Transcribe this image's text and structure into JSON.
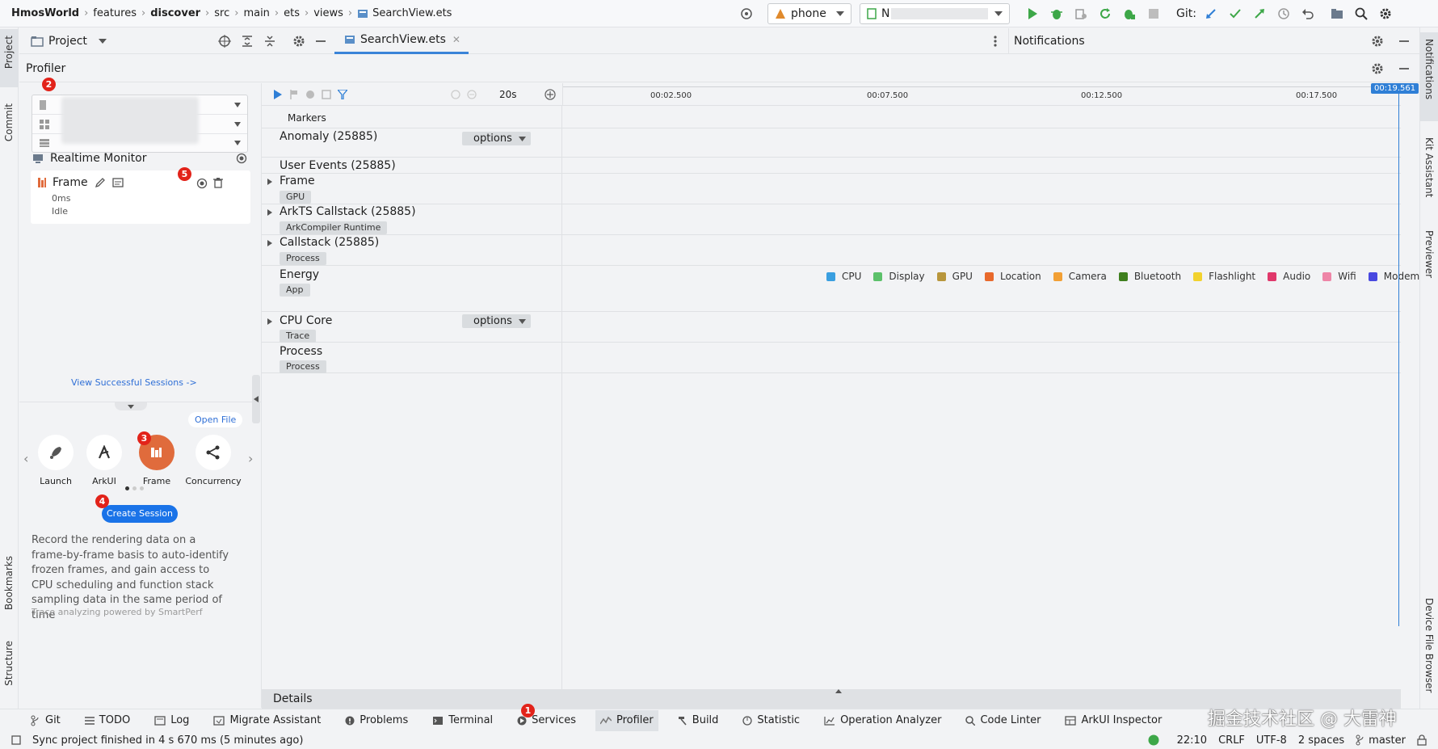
{
  "breadcrumb": [
    "HmosWorld",
    "features",
    "discover",
    "src",
    "main",
    "ets",
    "views",
    "SearchView.ets"
  ],
  "toolbar": {
    "device": "phone",
    "module": "N",
    "git_label": "Git:"
  },
  "project_panel": {
    "label": "Project"
  },
  "editor_tab": {
    "label": "SearchView.ets"
  },
  "notifications": {
    "label": "Notifications"
  },
  "profiler": {
    "title": "Profiler"
  },
  "sessions": {
    "realtime_monitor": "Realtime Monitor",
    "frame_title": "Frame",
    "frame_time": "0ms",
    "frame_status": "Idle",
    "view_sessions": "View Successful Sessions ->"
  },
  "templates": {
    "open_file": "Open File",
    "items": [
      "Launch",
      "ArkUI",
      "Frame",
      "Concurrency"
    ],
    "create_session": "Create Session",
    "description": "Record the rendering data on a frame-by-frame basis to auto-identify frozen frames, and gain access to CPU scheduling and function stack sampling data in the same period of time",
    "powered_by": "Trace analyzing powered by SmartPerf"
  },
  "badges": [
    "1",
    "2",
    "3",
    "4",
    "5"
  ],
  "timeline": {
    "duration": "20s",
    "ticks": [
      "00:02.500",
      "00:07.500",
      "00:12.500",
      "00:17.500"
    ],
    "current_time": "00:19.561"
  },
  "tracks": {
    "markers": "Markers",
    "anomaly": "Anomaly (25885)",
    "options": "options",
    "user_events": "User Events (25885)",
    "frame": "Frame",
    "frame_tag": "GPU",
    "arkts": "ArkTS Callstack (25885)",
    "arkts_tag": "ArkCompiler Runtime",
    "callstack": "Callstack (25885)",
    "callstack_tag": "Process",
    "energy": "Energy",
    "energy_tag": "App",
    "cpu_core": "CPU Core",
    "cpu_core_tag": "Trace",
    "process": "Process",
    "process_tag": "Process"
  },
  "energy_legend": [
    {
      "label": "CPU",
      "color": "#3a9fe0"
    },
    {
      "label": "Display",
      "color": "#5cc16a"
    },
    {
      "label": "GPU",
      "color": "#b8963c"
    },
    {
      "label": "Location",
      "color": "#e8692c"
    },
    {
      "label": "Camera",
      "color": "#f2a035"
    },
    {
      "label": "Bluetooth",
      "color": "#3f7f1e"
    },
    {
      "label": "Flashlight",
      "color": "#f2d22e"
    },
    {
      "label": "Audio",
      "color": "#e0386b"
    },
    {
      "label": "Wifi",
      "color": "#ee85a7"
    },
    {
      "label": "Modem",
      "color": "#4848e0"
    }
  ],
  "details": {
    "label": "Details"
  },
  "bottom_tabs": [
    "Git",
    "TODO",
    "Log",
    "Migrate Assistant",
    "Problems",
    "Terminal",
    "Services",
    "Profiler",
    "Build",
    "Statistic",
    "Operation Analyzer",
    "Code Linter",
    "ArkUI Inspector"
  ],
  "status": {
    "message": "Sync project finished in 4 s 670 ms (5 minutes ago)",
    "time": "22:10",
    "line_ending": "CRLF",
    "encoding": "UTF-8",
    "indent": "2 spaces",
    "branch": "master"
  },
  "left_strip": [
    "Project",
    "Commit",
    "Bookmarks",
    "Structure"
  ],
  "right_strip": [
    "Notifications",
    "Kit Assistant",
    "Previewer",
    "Device File Browser"
  ],
  "watermark": "掘金技术社区 @ 大雷神",
  "colors": {
    "accent": "#1a73e8",
    "frame_orange": "#e06b3c",
    "badge_red": "#e2231a",
    "run_green": "#3da748"
  }
}
